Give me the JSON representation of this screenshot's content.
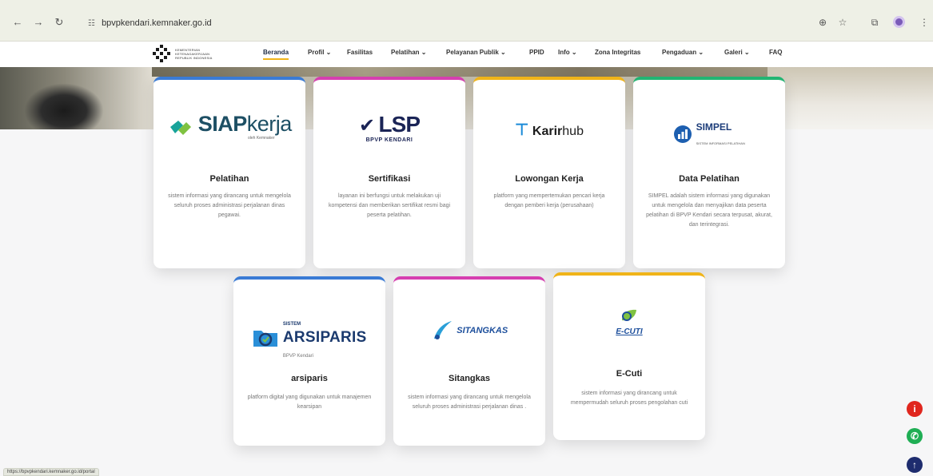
{
  "browser": {
    "url": "bpvpkendari.kemnaker.go.id",
    "back_icon": "arrow-left-icon",
    "forward_icon": "arrow-right-icon",
    "reload_icon": "reload-icon"
  },
  "site": {
    "logo_text": "KEMENTERIAN KETENAGAKERJAAN REPUBLIK INDONESIA",
    "nav": [
      {
        "label": "Beranda"
      },
      {
        "label": "Profil ⌄"
      },
      {
        "label": "Fasilitas"
      },
      {
        "label": "Pelatihan ⌄"
      },
      {
        "label": "Pelayanan Publik ⌄"
      },
      {
        "label": "PPID"
      },
      {
        "label": "Info ⌄"
      },
      {
        "label": "Zona Integritas"
      },
      {
        "label": "Pengaduan ⌄"
      },
      {
        "label": "Galeri ⌄"
      },
      {
        "label": "FAQ"
      }
    ]
  },
  "cards": [
    {
      "brand_main": "SIAP",
      "brand_sub": "kerja",
      "brand_note": "oleh Kemnaker",
      "title": "Pelatihan",
      "desc": "sistem informasi yang dirancang untuk mengelola seluruh proses administrasi perjalanan dinas pegawai.",
      "accent": "#3a7bd5"
    },
    {
      "brand_main": "LSP",
      "brand_sub": "BPVP KENDARI",
      "title": "Sertifikasi",
      "desc": "layanan ini berfungsi untuk melakukan uji kompetensi dan memberikan sertifikat resmi bagi peserta pelatihan.",
      "accent": "#d63fb0"
    },
    {
      "brand_main": "Karir",
      "brand_sub": "hub",
      "title": "Lowongan Kerja",
      "desc": "platform yang mempertemukan pencari kerja dengan pemberi kerja (perusahaan)",
      "accent": "#f0b419"
    },
    {
      "brand_main": "SIMPEL",
      "brand_sub": "SISTEM INFORMASI PELATIHAN",
      "title": "Data Pelatihan",
      "desc": "SIMPEL adalah sistem informasi yang digunakan untuk mengelola dan menyajikan data peserta pelatihan di BPVP Kendari secara terpusat, akurat, dan terintegrasi.",
      "accent": "#22b573"
    },
    {
      "brand_main": "ARSIPARIS",
      "brand_top": "SISTEM",
      "brand_sub": "BPVP Kendari",
      "title": "arsiparis",
      "desc": "platform digital yang digunakan untuk manajemen kearsipan",
      "accent": "#3a7bd5"
    },
    {
      "brand_main": "SITANGKAS",
      "title": "Sitangkas",
      "desc": "sistem informasi yang dirancang untuk mengelola seluruh proses administrasi perjalanan dinas .",
      "accent": "#d63fb0"
    },
    {
      "brand_main": "E-CUTI",
      "title": "E-Cuti",
      "desc": "sistem informasi yang dirancang untuk mempermudah seluruh proses pengolahan cuti",
      "accent": "#f0b419"
    }
  ],
  "floating": {
    "info_icon": "info-icon",
    "whatsapp_icon": "whatsapp-icon",
    "top_icon": "arrow-up-icon"
  },
  "status_url": "https://bpvpkendari.kemnaker.go.id/portal"
}
